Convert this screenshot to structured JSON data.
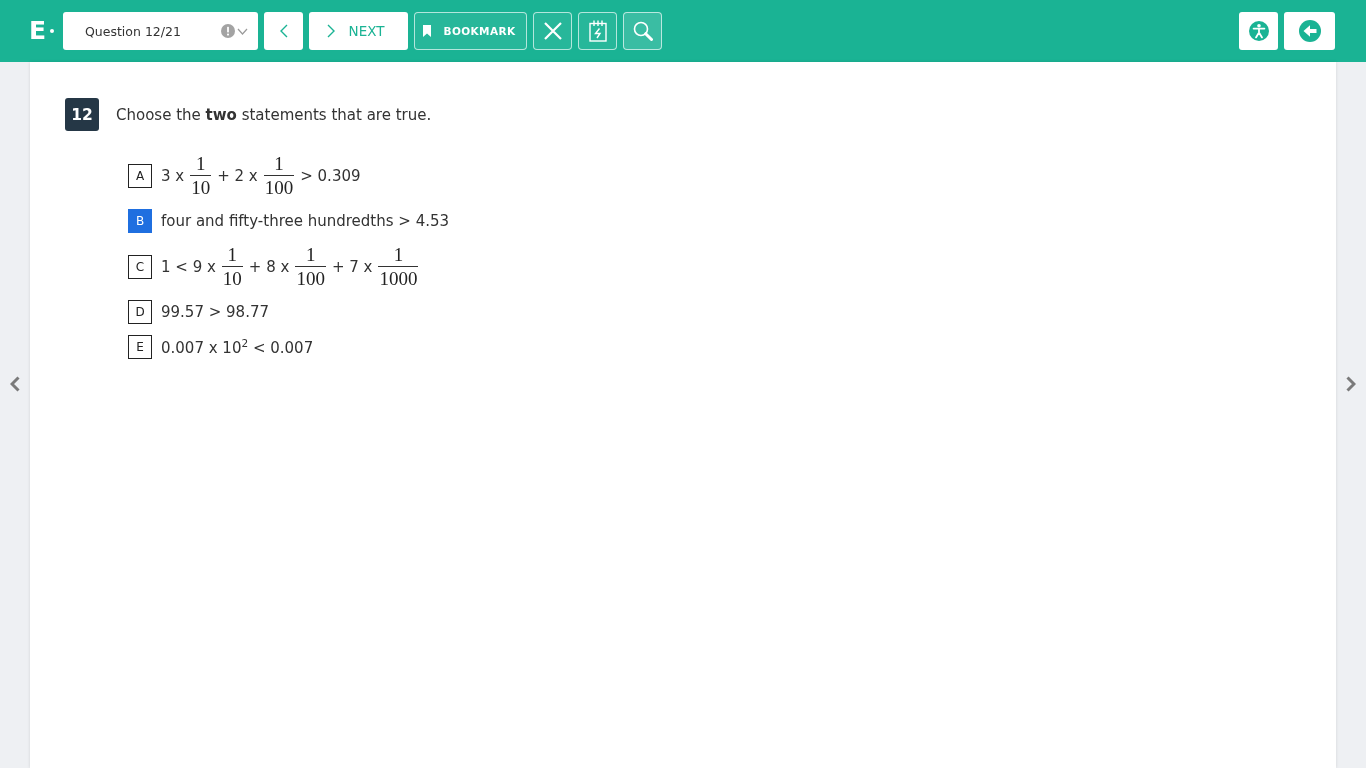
{
  "top_bar": {
    "logo": "E",
    "question_picker": {
      "value": "Question 12/21"
    },
    "next_button": {
      "label": "NEXT"
    },
    "bookmark_button": {
      "label": "BOOKMARK"
    }
  },
  "question": {
    "number": "12",
    "prompt": "Choose the **two** statements that are true.",
    "options": [
      {
        "letter": "A",
        "selected": false,
        "parts": [
          {
            "kind": "text",
            "text": "3 x"
          },
          {
            "kind": "fraction",
            "numerator": "1",
            "denominator": "10"
          },
          {
            "kind": "text",
            "text": "+ 2 x"
          },
          {
            "kind": "fraction",
            "numerator": "1",
            "denominator": "100"
          },
          {
            "kind": "text",
            "text": "> 0.309"
          }
        ]
      },
      {
        "letter": "B",
        "selected": true,
        "parts": [
          {
            "kind": "text",
            "text": "four and fifty-three hundredths > 4.53"
          }
        ]
      },
      {
        "letter": "C",
        "selected": false,
        "parts": [
          {
            "kind": "text",
            "text": "1 < 9 x"
          },
          {
            "kind": "fraction",
            "numerator": "1",
            "denominator": "10"
          },
          {
            "kind": "text",
            "text": "+ 8 x"
          },
          {
            "kind": "fraction",
            "numerator": "1",
            "denominator": "100"
          },
          {
            "kind": "text",
            "text": "+ 7 x"
          },
          {
            "kind": "fraction",
            "numerator": "1",
            "denominator": "1000"
          }
        ]
      },
      {
        "letter": "D",
        "selected": false,
        "parts": [
          {
            "kind": "text",
            "text": "99.57 > 98.77"
          }
        ]
      },
      {
        "letter": "E",
        "selected": false,
        "parts": [
          {
            "kind": "text",
            "text": "0.007 x 10$^{2}$ < 0.007"
          }
        ]
      }
    ]
  }
}
